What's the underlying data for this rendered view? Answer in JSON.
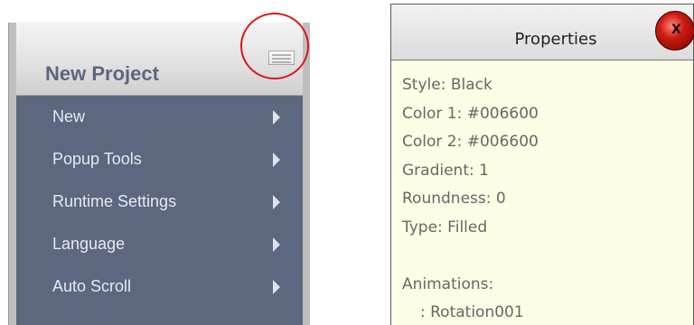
{
  "project_menu": {
    "title": "New Project",
    "items": [
      {
        "label": "New"
      },
      {
        "label": "Popup Tools"
      },
      {
        "label": "Runtime Settings"
      },
      {
        "label": "Language"
      },
      {
        "label": "Auto Scroll"
      }
    ],
    "options_icon": "menu-options-icon",
    "submenu_icon": "chevron-right-icon",
    "colors": {
      "list_background": "#5c6780",
      "title_text": "#5c6780",
      "highlight_circle": "#e01414"
    }
  },
  "properties_panel": {
    "title": "Properties",
    "close_label": "X",
    "close_icon": "close-icon",
    "lines": [
      "Style: Black",
      "Color 1: #006600",
      "Color 2: #006600",
      "Gradient: 1",
      "Roundness: 0",
      "Type: Filled"
    ],
    "animations_label": "Animations:",
    "animations": [
      ": Rotation001"
    ],
    "colors": {
      "background": "#fefee6",
      "text": "#676767",
      "close_button": "#cc1b12"
    }
  }
}
